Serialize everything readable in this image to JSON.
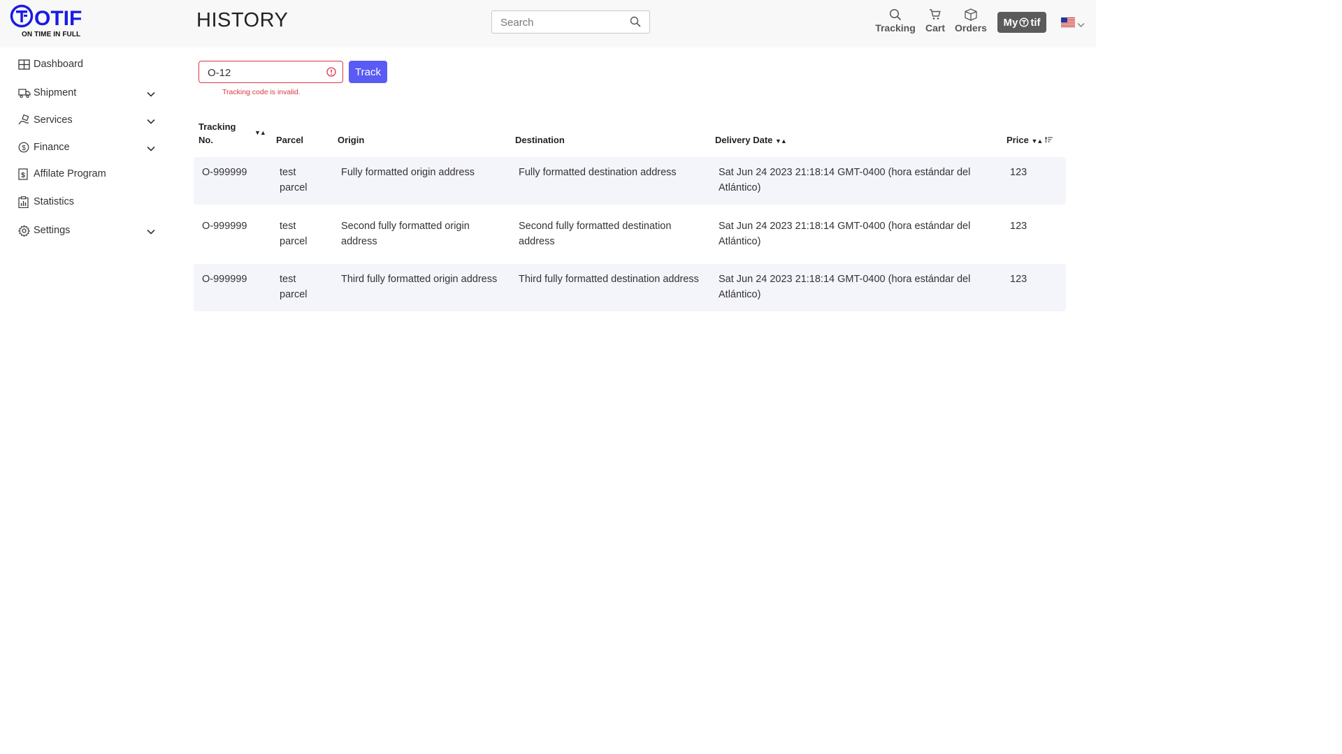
{
  "brand": {
    "name": "OTIF",
    "tagline": "ON TIME IN FULL"
  },
  "page": {
    "title": "HISTORY"
  },
  "search": {
    "placeholder": "Search",
    "value": ""
  },
  "nav": {
    "tracking": "Tracking",
    "cart": "Cart",
    "orders": "Orders",
    "my_label": "My",
    "my_brand": "tif"
  },
  "sidebar": {
    "items": [
      {
        "label": "Dashboard",
        "icon": "dashboard-icon",
        "expandable": false
      },
      {
        "label": "Shipment",
        "icon": "truck-icon",
        "expandable": true
      },
      {
        "label": "Services",
        "icon": "hand-box-icon",
        "expandable": true
      },
      {
        "label": "Finance",
        "icon": "dollar-circle-icon",
        "expandable": true
      },
      {
        "label": "Affilate Program",
        "icon": "dollar-page-icon",
        "expandable": false
      },
      {
        "label": "Statistics",
        "icon": "clipboard-chart-icon",
        "expandable": false
      },
      {
        "label": "Settings",
        "icon": "gear-icon",
        "expandable": true
      }
    ]
  },
  "tracker": {
    "value": "O-12",
    "button": "Track",
    "error": "Tracking code is invalid."
  },
  "table": {
    "headers": {
      "tracking_line1": "Tracking",
      "tracking_line2": "No.",
      "parcel": "Parcel",
      "origin": "Origin",
      "destination": "Destination",
      "delivery_date": "Delivery Date",
      "price": "Price"
    },
    "rows": [
      {
        "tracking": "O-999999",
        "parcel_line1": "test",
        "parcel_line2": "parcel",
        "origin_line1": "Fully formatted origin address",
        "origin_line2": "",
        "destination_line1": "Fully formatted destination address",
        "destination_line2": "",
        "date_line1": "Sat Jun 24 2023 21:18:14 GMT-0400 (hora estándar del",
        "date_line2": "Atlántico)",
        "price": "123"
      },
      {
        "tracking": "O-999999",
        "parcel_line1": "test",
        "parcel_line2": "parcel",
        "origin_line1": "Second fully formatted origin",
        "origin_line2": "address",
        "destination_line1": "Second fully formatted destination",
        "destination_line2": "address",
        "date_line1": "Sat Jun 24 2023 21:18:14 GMT-0400 (hora estándar del",
        "date_line2": "Atlántico)",
        "price": "123"
      },
      {
        "tracking": "O-999999",
        "parcel_line1": "test",
        "parcel_line2": "parcel",
        "origin_line1": "Third fully formatted origin address",
        "origin_line2": "",
        "destination_line1": "Third fully formatted destination address",
        "destination_line2": "",
        "date_line1": "Sat Jun 24 2023 21:18:14 GMT-0400 (hora estándar del",
        "date_line2": "Atlántico)",
        "price": "123"
      }
    ]
  },
  "colors": {
    "brand_blue": "#1a1ae6",
    "accent": "#5a5af5",
    "error": "#dc3545",
    "row_shade": "#f4f4fb"
  }
}
